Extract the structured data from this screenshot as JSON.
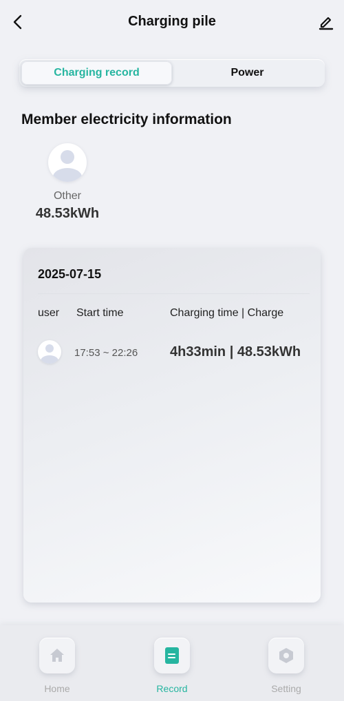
{
  "header": {
    "title": "Charging pile"
  },
  "tabs": [
    {
      "label": "Charging record",
      "active": true
    },
    {
      "label": "Power",
      "active": false
    }
  ],
  "section_title": "Member electricity information",
  "member": {
    "name": "Other",
    "value": "48.53kWh"
  },
  "record": {
    "date": "2025-07-15",
    "columns": {
      "user": "user",
      "start_time": "Start time",
      "charging": "Charging time | Charge"
    },
    "rows": [
      {
        "time_range": "17:53 ~ 22:26",
        "charge": "4h33min | 48.53kWh"
      }
    ]
  },
  "nav": [
    {
      "label": "Home",
      "icon": "home-icon",
      "active": false
    },
    {
      "label": "Record",
      "icon": "record-icon",
      "active": true
    },
    {
      "label": "Setting",
      "icon": "setting-icon",
      "active": false
    }
  ],
  "colors": {
    "accent": "#26b5a0",
    "background": "#f0f1f5"
  }
}
